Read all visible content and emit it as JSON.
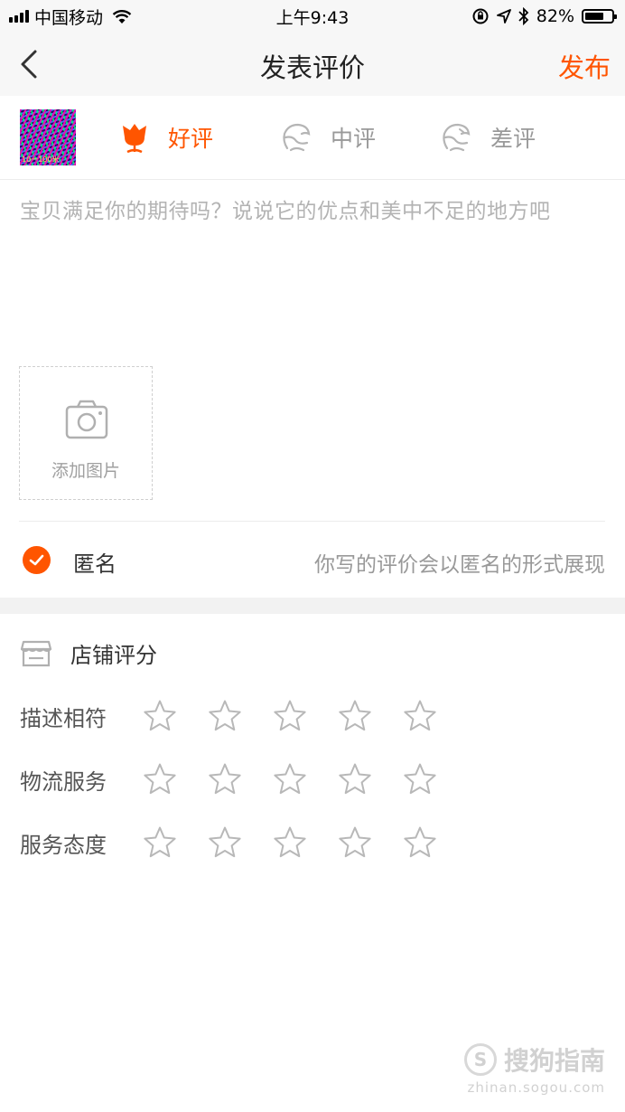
{
  "status_bar": {
    "carrier": "中国移动",
    "time": "上午9:43",
    "battery_percent": "82%",
    "battery_level": 0.82
  },
  "nav": {
    "title": "发表评价",
    "publish_label": "发布",
    "back_icon": "chevron-left-icon"
  },
  "product": {
    "thumbnail_caption": "10一100米"
  },
  "rating_options": [
    {
      "label": "好评",
      "icon": "flower-icon",
      "selected": true
    },
    {
      "label": "中评",
      "icon": "neutral-face-icon",
      "selected": false
    },
    {
      "label": "差评",
      "icon": "sad-face-icon",
      "selected": false
    }
  ],
  "review": {
    "placeholder": "宝贝满足你的期待吗？说说它的优点和美中不足的地方吧",
    "value": ""
  },
  "add_photo": {
    "label": "添加图片",
    "icon": "camera-icon"
  },
  "anonymous": {
    "label": "匿名",
    "checked": true,
    "hint": "你写的评价会以匿名的形式展现"
  },
  "shop_rating": {
    "title": "店铺评分",
    "icon": "shop-icon",
    "rows": [
      {
        "label": "描述相符",
        "stars_selected": 0,
        "max_stars": 5
      },
      {
        "label": "物流服务",
        "stars_selected": 0,
        "max_stars": 5
      },
      {
        "label": "服务态度",
        "stars_selected": 0,
        "max_stars": 5
      }
    ]
  },
  "watermark": {
    "logo_char": "S",
    "text": "搜狗指南",
    "url": "zhinan.sogou.com"
  },
  "colors": {
    "accent": "#ff5500",
    "muted": "#999999",
    "placeholder": "#b3b3b3"
  }
}
